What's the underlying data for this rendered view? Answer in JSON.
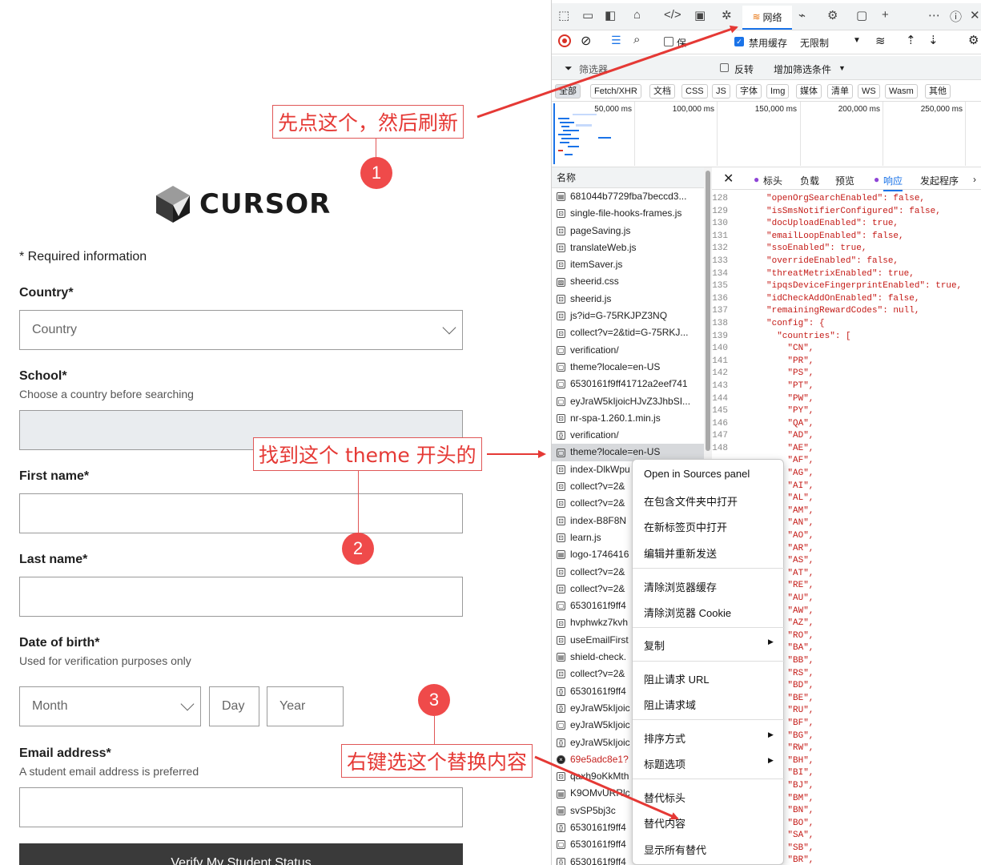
{
  "form": {
    "logo_text": "CURSOR",
    "required_note": "* Required information",
    "country_label": "Country*",
    "country_placeholder": "Country",
    "school_label": "School*",
    "school_help": "Choose a country before searching",
    "first_name_label": "First name*",
    "last_name_label": "Last name*",
    "dob_label": "Date of birth*",
    "dob_help": "Used for verification purposes only",
    "month_placeholder": "Month",
    "day_placeholder": "Day",
    "year_placeholder": "Year",
    "email_label": "Email address*",
    "email_help": "A student email address is preferred",
    "submit_label": "Verify My Student Status"
  },
  "annotations": {
    "step1_text": "先点这个，然后刷新",
    "step1_num": "1",
    "step2_text": "找到这个 theme 开头的",
    "step2_num": "2",
    "step3_text": "右键选这个替换内容",
    "step3_num": "3",
    "arrow_color": "#e53935"
  },
  "devtools": {
    "network_tab": "网络",
    "disable_cache": "禁用缓存",
    "throttle": "无限制",
    "preserve_log_partial": "保",
    "filter_placeholder": "筛选器",
    "invert": "反转",
    "more_filters": "增加筛选条件",
    "type_filters": [
      "全部",
      "Fetch/XHR",
      "文档",
      "CSS",
      "JS",
      "字体",
      "Img",
      "媒体",
      "清单",
      "WS",
      "Wasm",
      "其他"
    ],
    "timeline_ticks": [
      "50,000 ms",
      "100,000 ms",
      "150,000 ms",
      "200,000 ms",
      "250,000 ms"
    ],
    "name_header": "名称",
    "requests": [
      "681044b7729fba7beccd3...",
      "single-file-hooks-frames.js",
      "pageSaving.js",
      "translateWeb.js",
      "itemSaver.js",
      "sheerid.css",
      "sheerid.js",
      "js?id=G-75RKJPZ3NQ",
      "collect?v=2&tid=G-75RKJ...",
      "verification/",
      "theme?locale=en-US",
      "6530161f9ff41712a2eef741",
      "eyJraW5kIjoicHJvZ3JhbSI...",
      "nr-spa-1.260.1.min.js",
      "verification/",
      "theme?locale=en-US",
      "index-DlkWpu",
      "collect?v=2&",
      "collect?v=2&",
      "index-B8F8N",
      "learn.js",
      "logo-1746416",
      "collect?v=2&",
      "collect?v=2&",
      "6530161f9ff4",
      "hvphwkz7kvh",
      "useEmailFirst",
      "shield-check.",
      "collect?v=2&",
      "6530161f9ff4",
      "eyJraW5kIjoic",
      "eyJraW5kIjoic",
      "eyJraW5kIjoic",
      "69e5adc8e1?",
      "qaxh9oKkMth",
      "K9OMvURRlc",
      "svSP5bj3c",
      "6530161f9ff4",
      "6530161f9ff4",
      "6530161f9ff4"
    ],
    "response_tabs": [
      "标头",
      "负载",
      "预览",
      "响应",
      "发起程序"
    ],
    "code_lines": [
      {
        "n": "128",
        "text": "\"openOrgSearchEnabled\": false,"
      },
      {
        "n": "129",
        "text": "\"isSmsNotifierConfigured\": false,"
      },
      {
        "n": "130",
        "text": "\"docUploadEnabled\": true,"
      },
      {
        "n": "131",
        "text": "\"emailLoopEnabled\": false,"
      },
      {
        "n": "132",
        "text": "\"ssoEnabled\": true,"
      },
      {
        "n": "133",
        "text": "\"overrideEnabled\": false,"
      },
      {
        "n": "134",
        "text": "\"threatMetrixEnabled\": true,"
      },
      {
        "n": "135",
        "text": "\"ipqsDeviceFingerprintEnabled\": true,"
      },
      {
        "n": "136",
        "text": "\"idCheckAddOnEnabled\": false,"
      },
      {
        "n": "137",
        "text": "\"remainingRewardCodes\": null,"
      },
      {
        "n": "138",
        "text": "\"config\": {"
      },
      {
        "n": "139",
        "text": "  \"countries\": ["
      },
      {
        "n": "140",
        "text": "    \"CN\","
      },
      {
        "n": "141",
        "text": "    \"PR\","
      },
      {
        "n": "142",
        "text": "    \"PS\","
      },
      {
        "n": "143",
        "text": "    \"PT\","
      },
      {
        "n": "144",
        "text": "    \"PW\","
      },
      {
        "n": "145",
        "text": "    \"PY\","
      },
      {
        "n": "146",
        "text": "    \"QA\","
      },
      {
        "n": "147",
        "text": "    \"AD\","
      },
      {
        "n": "148",
        "text": "    \"AE\","
      },
      {
        "n": "",
        "text": "    \"AF\","
      },
      {
        "n": "",
        "text": "    \"AG\","
      },
      {
        "n": "",
        "text": "    \"AI\","
      },
      {
        "n": "",
        "text": "    \"AL\","
      },
      {
        "n": "",
        "text": "    \"AM\","
      },
      {
        "n": "",
        "text": "    \"AN\","
      },
      {
        "n": "",
        "text": "    \"AO\","
      },
      {
        "n": "",
        "text": "    \"AR\","
      },
      {
        "n": "",
        "text": "    \"AS\","
      },
      {
        "n": "",
        "text": "    \"AT\","
      },
      {
        "n": "",
        "text": "    \"RE\","
      },
      {
        "n": "",
        "text": "    \"AU\","
      },
      {
        "n": "",
        "text": "    \"AW\","
      },
      {
        "n": "",
        "text": "    \"AZ\","
      },
      {
        "n": "",
        "text": "    \"RO\","
      },
      {
        "n": "",
        "text": "    \"BA\","
      },
      {
        "n": "",
        "text": "    \"BB\","
      },
      {
        "n": "",
        "text": "    \"RS\","
      },
      {
        "n": "",
        "text": "    \"BD\","
      },
      {
        "n": "",
        "text": "    \"BE\","
      },
      {
        "n": "",
        "text": "    \"RU\","
      },
      {
        "n": "",
        "text": "    \"BF\","
      },
      {
        "n": "",
        "text": "    \"BG\","
      },
      {
        "n": "",
        "text": "    \"RW\","
      },
      {
        "n": "",
        "text": "    \"BH\","
      },
      {
        "n": "",
        "text": "    \"BI\","
      },
      {
        "n": "",
        "text": "    \"BJ\","
      },
      {
        "n": "",
        "text": "    \"BM\","
      },
      {
        "n": "",
        "text": "    \"BN\","
      },
      {
        "n": "",
        "text": "    \"BO\","
      },
      {
        "n": "",
        "text": "    \"SA\","
      },
      {
        "n": "",
        "text": "    \"SB\","
      },
      {
        "n": "",
        "text": "    \"BR\","
      }
    ]
  },
  "context_menu": {
    "open_in_sources": "Open in Sources panel",
    "open_in_folder": "在包含文件夹中打开",
    "open_in_new_tab": "在新标签页中打开",
    "edit_resend": "编辑并重新发送",
    "clear_cache": "清除浏览器缓存",
    "clear_cookies": "清除浏览器 Cookie",
    "copy": "复制",
    "block_url": "阻止请求 URL",
    "block_domain": "阻止请求域",
    "sort_by": "排序方式",
    "header_options": "标题选项",
    "override_headers": "替代标头",
    "override_content": "替代内容",
    "show_all_overrides": "显示所有替代"
  }
}
